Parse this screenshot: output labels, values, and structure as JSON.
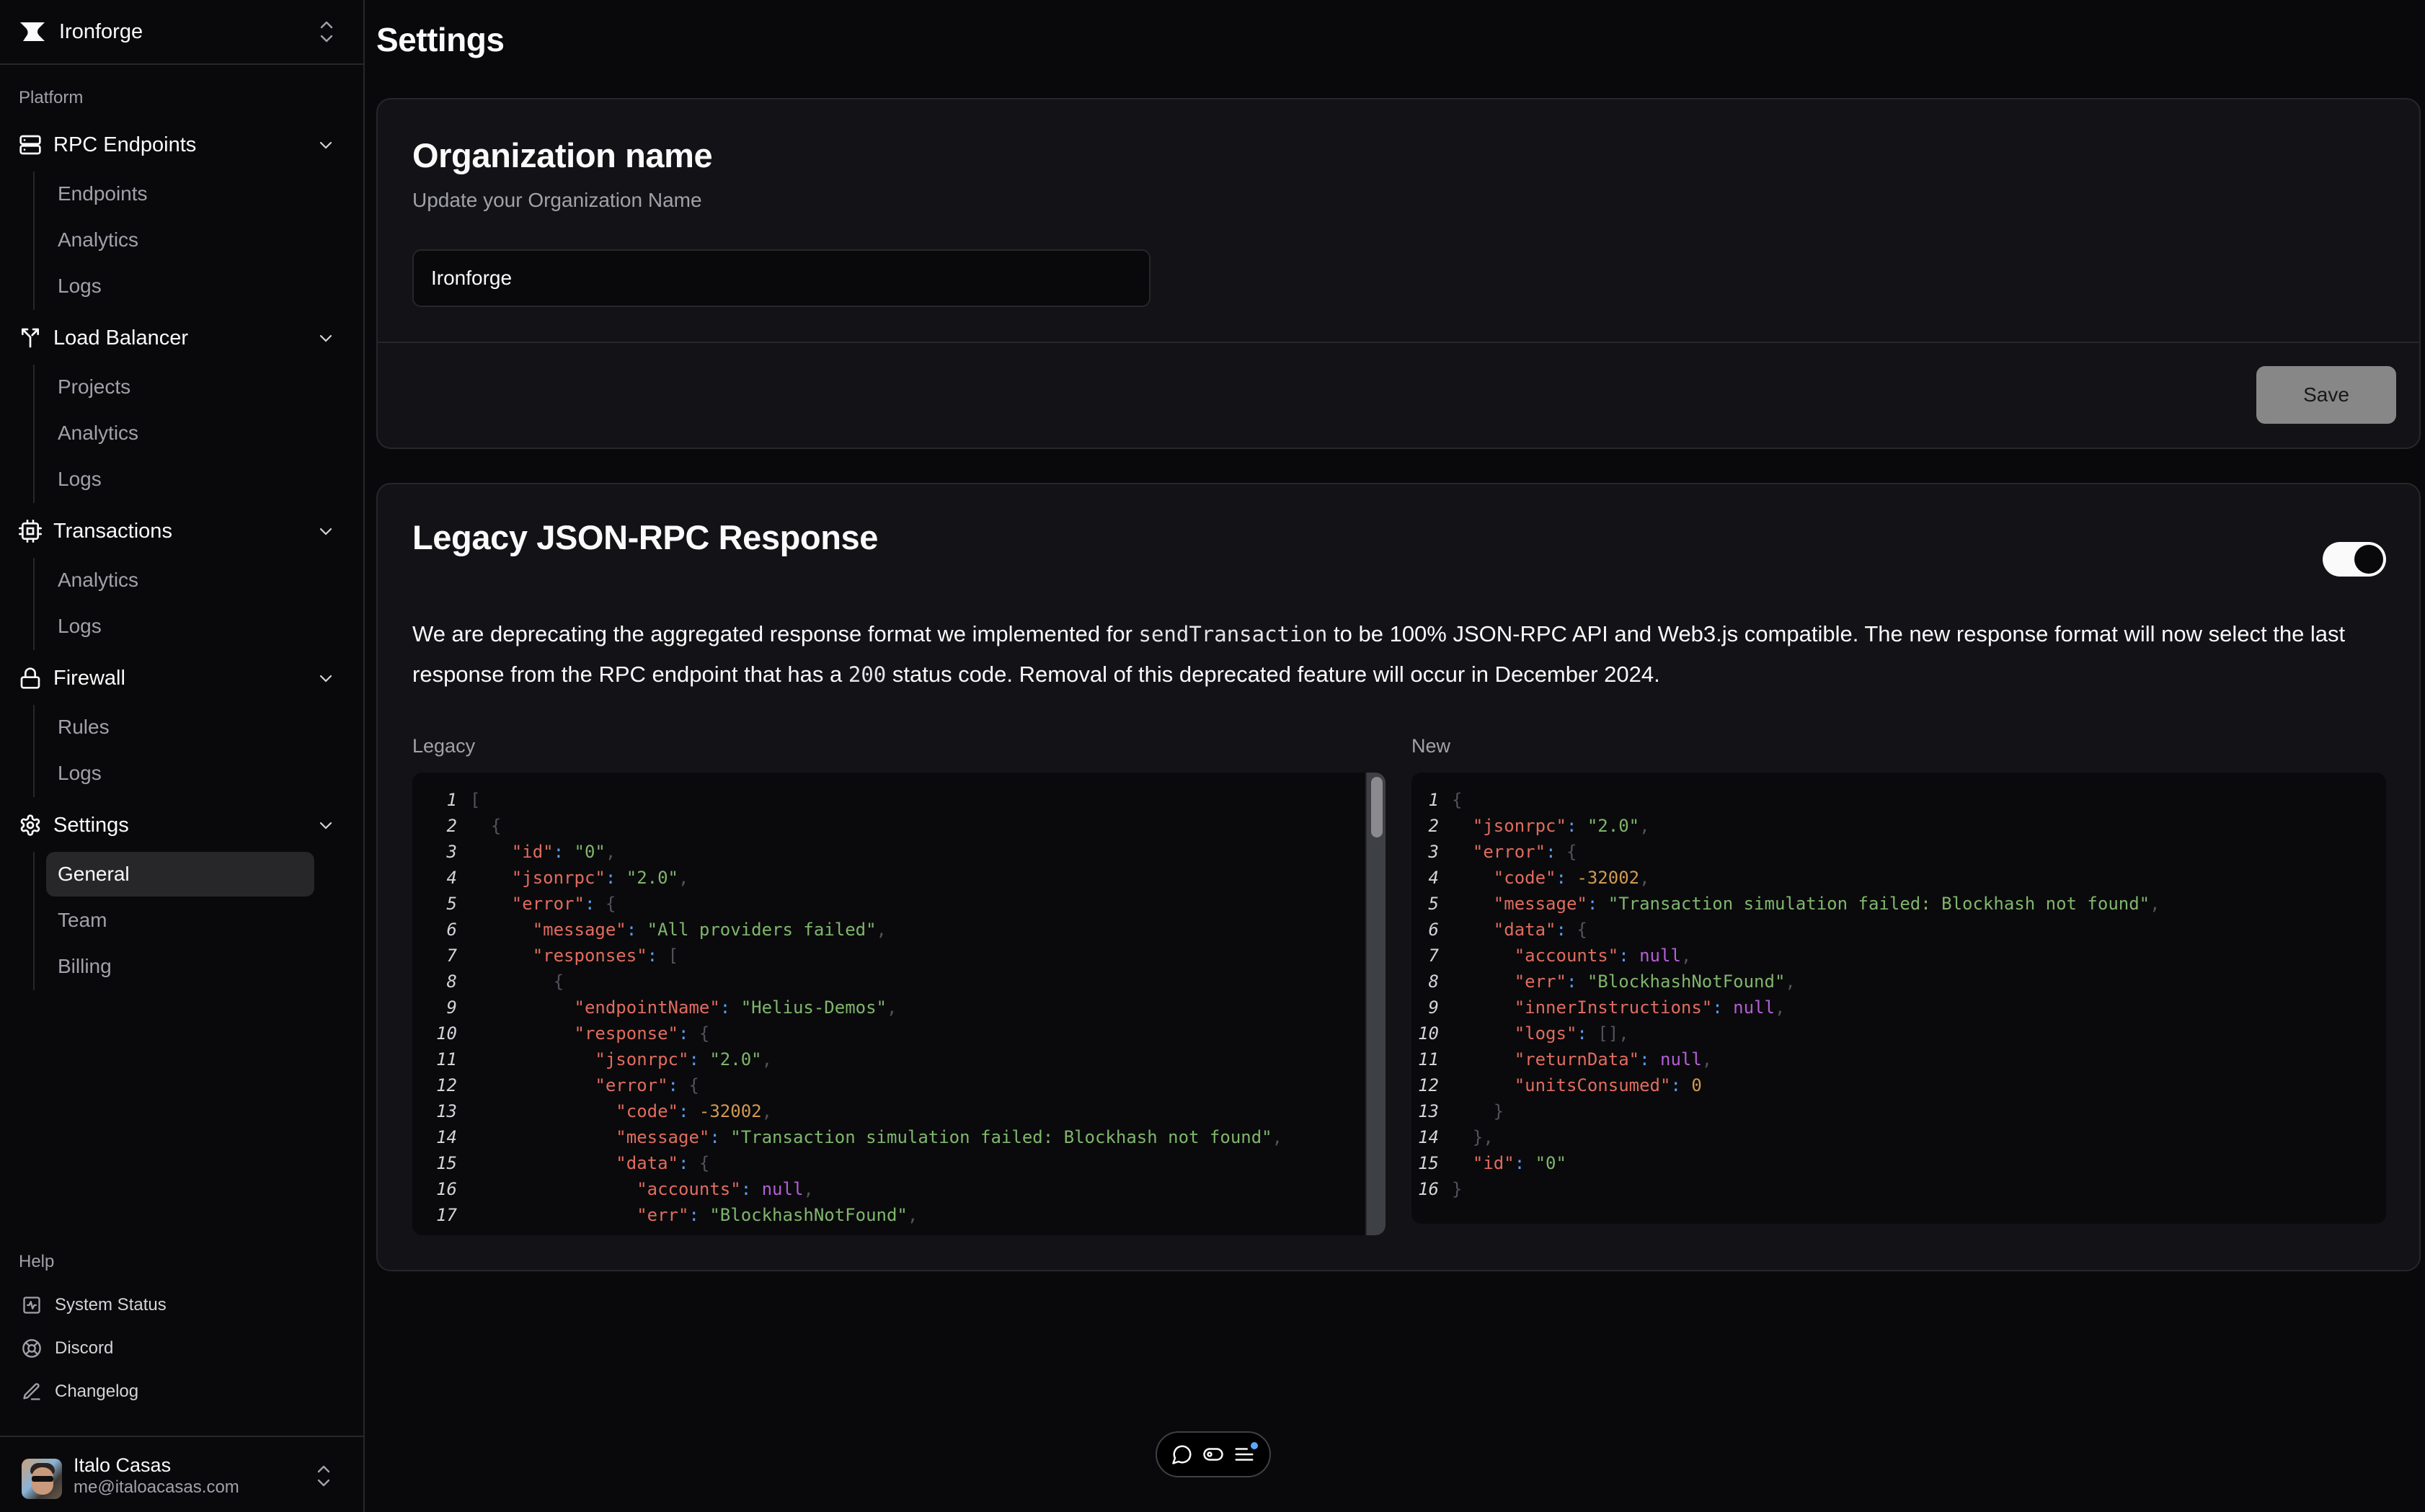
{
  "org": {
    "name": "Ironforge"
  },
  "sidebar": {
    "platform_label": "Platform",
    "groups": [
      {
        "label": "RPC Endpoints",
        "icon": "server-icon",
        "items": [
          {
            "label": "Endpoints"
          },
          {
            "label": "Analytics"
          },
          {
            "label": "Logs"
          }
        ]
      },
      {
        "label": "Load Balancer",
        "icon": "split-icon",
        "items": [
          {
            "label": "Projects"
          },
          {
            "label": "Analytics"
          },
          {
            "label": "Logs"
          }
        ]
      },
      {
        "label": "Transactions",
        "icon": "cpu-icon",
        "items": [
          {
            "label": "Analytics"
          },
          {
            "label": "Logs"
          }
        ]
      },
      {
        "label": "Firewall",
        "icon": "lock-icon",
        "items": [
          {
            "label": "Rules"
          },
          {
            "label": "Logs"
          }
        ]
      },
      {
        "label": "Settings",
        "icon": "gear-icon",
        "items": [
          {
            "label": "General",
            "active": true
          },
          {
            "label": "Team"
          },
          {
            "label": "Billing"
          }
        ]
      }
    ],
    "help_label": "Help",
    "help_items": [
      {
        "label": "System Status",
        "icon": "activity-icon"
      },
      {
        "label": "Discord",
        "icon": "lifebuoy-icon"
      },
      {
        "label": "Changelog",
        "icon": "pen-icon"
      }
    ],
    "user": {
      "name": "Italo Casas",
      "email": "me@italoacasas.com"
    }
  },
  "page": {
    "title": "Settings"
  },
  "org_card": {
    "title": "Organization name",
    "subtitle": "Update your Organization Name",
    "input_value": "Ironforge",
    "save_label": "Save"
  },
  "legacy_card": {
    "title": "Legacy JSON-RPC Response",
    "toggle_on": true,
    "para": {
      "p1": "We are deprecating the aggregated response format we implemented for ",
      "code1": "sendTransaction",
      "p2": " to be 100% JSON-RPC API and Web3.js compatible. The new response format will now select the last response from the RPC endpoint that has a ",
      "code2": "200",
      "p3": " status code. Removal of this deprecated feature will occur in December 2024."
    },
    "legacy_label": "Legacy",
    "new_label": "New",
    "legacy_code": [
      [
        [
          "punct",
          "["
        ]
      ],
      [
        [
          "sp",
          "  "
        ],
        [
          "punct",
          "{"
        ]
      ],
      [
        [
          "sp",
          "    "
        ],
        [
          "key",
          "\"id\""
        ],
        [
          "colon",
          ": "
        ],
        [
          "str",
          "\"0\""
        ],
        [
          "punct",
          ","
        ]
      ],
      [
        [
          "sp",
          "    "
        ],
        [
          "key",
          "\"jsonrpc\""
        ],
        [
          "colon",
          ": "
        ],
        [
          "str",
          "\"2.0\""
        ],
        [
          "punct",
          ","
        ]
      ],
      [
        [
          "sp",
          "    "
        ],
        [
          "key",
          "\"error\""
        ],
        [
          "colon",
          ": "
        ],
        [
          "punct",
          "{"
        ]
      ],
      [
        [
          "sp",
          "      "
        ],
        [
          "key",
          "\"message\""
        ],
        [
          "colon",
          ": "
        ],
        [
          "str",
          "\"All providers failed\""
        ],
        [
          "punct",
          ","
        ]
      ],
      [
        [
          "sp",
          "      "
        ],
        [
          "key",
          "\"responses\""
        ],
        [
          "colon",
          ": "
        ],
        [
          "punct",
          "["
        ]
      ],
      [
        [
          "sp",
          "        "
        ],
        [
          "punct",
          "{"
        ]
      ],
      [
        [
          "sp",
          "          "
        ],
        [
          "key",
          "\"endpointName\""
        ],
        [
          "colon",
          ": "
        ],
        [
          "str",
          "\"Helius-Demos\""
        ],
        [
          "punct",
          ","
        ]
      ],
      [
        [
          "sp",
          "          "
        ],
        [
          "key",
          "\"response\""
        ],
        [
          "colon",
          ": "
        ],
        [
          "punct",
          "{"
        ]
      ],
      [
        [
          "sp",
          "            "
        ],
        [
          "key",
          "\"jsonrpc\""
        ],
        [
          "colon",
          ": "
        ],
        [
          "str",
          "\"2.0\""
        ],
        [
          "punct",
          ","
        ]
      ],
      [
        [
          "sp",
          "            "
        ],
        [
          "key",
          "\"error\""
        ],
        [
          "colon",
          ": "
        ],
        [
          "punct",
          "{"
        ]
      ],
      [
        [
          "sp",
          "              "
        ],
        [
          "key",
          "\"code\""
        ],
        [
          "colon",
          ": "
        ],
        [
          "num",
          "-32002"
        ],
        [
          "punct",
          ","
        ]
      ],
      [
        [
          "sp",
          "              "
        ],
        [
          "key",
          "\"message\""
        ],
        [
          "colon",
          ": "
        ],
        [
          "str",
          "\"Transaction simulation failed: Blockhash not found\""
        ],
        [
          "punct",
          ","
        ]
      ],
      [
        [
          "sp",
          "              "
        ],
        [
          "key",
          "\"data\""
        ],
        [
          "colon",
          ": "
        ],
        [
          "punct",
          "{"
        ]
      ],
      [
        [
          "sp",
          "                "
        ],
        [
          "key",
          "\"accounts\""
        ],
        [
          "colon",
          ": "
        ],
        [
          "null",
          "null"
        ],
        [
          "punct",
          ","
        ]
      ],
      [
        [
          "sp",
          "                "
        ],
        [
          "key",
          "\"err\""
        ],
        [
          "colon",
          ": "
        ],
        [
          "str",
          "\"BlockhashNotFound\""
        ],
        [
          "punct",
          ","
        ]
      ]
    ],
    "new_code": [
      [
        [
          "punct",
          "{"
        ]
      ],
      [
        [
          "sp",
          "  "
        ],
        [
          "key",
          "\"jsonrpc\""
        ],
        [
          "colon",
          ": "
        ],
        [
          "str",
          "\"2.0\""
        ],
        [
          "punct",
          ","
        ]
      ],
      [
        [
          "sp",
          "  "
        ],
        [
          "key",
          "\"error\""
        ],
        [
          "colon",
          ": "
        ],
        [
          "punct",
          "{"
        ]
      ],
      [
        [
          "sp",
          "    "
        ],
        [
          "key",
          "\"code\""
        ],
        [
          "colon",
          ": "
        ],
        [
          "num",
          "-32002"
        ],
        [
          "punct",
          ","
        ]
      ],
      [
        [
          "sp",
          "    "
        ],
        [
          "key",
          "\"message\""
        ],
        [
          "colon",
          ": "
        ],
        [
          "str",
          "\"Transaction simulation failed: Blockhash not found\""
        ],
        [
          "punct",
          ","
        ]
      ],
      [
        [
          "sp",
          "    "
        ],
        [
          "key",
          "\"data\""
        ],
        [
          "colon",
          ": "
        ],
        [
          "punct",
          "{"
        ]
      ],
      [
        [
          "sp",
          "      "
        ],
        [
          "key",
          "\"accounts\""
        ],
        [
          "colon",
          ": "
        ],
        [
          "null",
          "null"
        ],
        [
          "punct",
          ","
        ]
      ],
      [
        [
          "sp",
          "      "
        ],
        [
          "key",
          "\"err\""
        ],
        [
          "colon",
          ": "
        ],
        [
          "str",
          "\"BlockhashNotFound\""
        ],
        [
          "punct",
          ","
        ]
      ],
      [
        [
          "sp",
          "      "
        ],
        [
          "key",
          "\"innerInstructions\""
        ],
        [
          "colon",
          ": "
        ],
        [
          "null",
          "null"
        ],
        [
          "punct",
          ","
        ]
      ],
      [
        [
          "sp",
          "      "
        ],
        [
          "key",
          "\"logs\""
        ],
        [
          "colon",
          ": "
        ],
        [
          "punct",
          "[],"
        ]
      ],
      [
        [
          "sp",
          "      "
        ],
        [
          "key",
          "\"returnData\""
        ],
        [
          "colon",
          ": "
        ],
        [
          "null",
          "null"
        ],
        [
          "punct",
          ","
        ]
      ],
      [
        [
          "sp",
          "      "
        ],
        [
          "key",
          "\"unitsConsumed\""
        ],
        [
          "colon",
          ": "
        ],
        [
          "num",
          "0"
        ]
      ],
      [
        [
          "sp",
          "    "
        ],
        [
          "punct",
          "}"
        ]
      ],
      [
        [
          "sp",
          "  "
        ],
        [
          "punct",
          "},"
        ]
      ],
      [
        [
          "sp",
          "  "
        ],
        [
          "key",
          "\"id\""
        ],
        [
          "colon",
          ": "
        ],
        [
          "str",
          "\"0\""
        ]
      ],
      [
        [
          "punct",
          "}"
        ]
      ]
    ]
  },
  "floating_toolbar": {
    "buttons": [
      {
        "icon": "comment-icon"
      },
      {
        "icon": "toggle-view-icon"
      },
      {
        "icon": "menu-icon",
        "has_badge": true
      }
    ],
    "badge_color": "#60a5fa"
  }
}
